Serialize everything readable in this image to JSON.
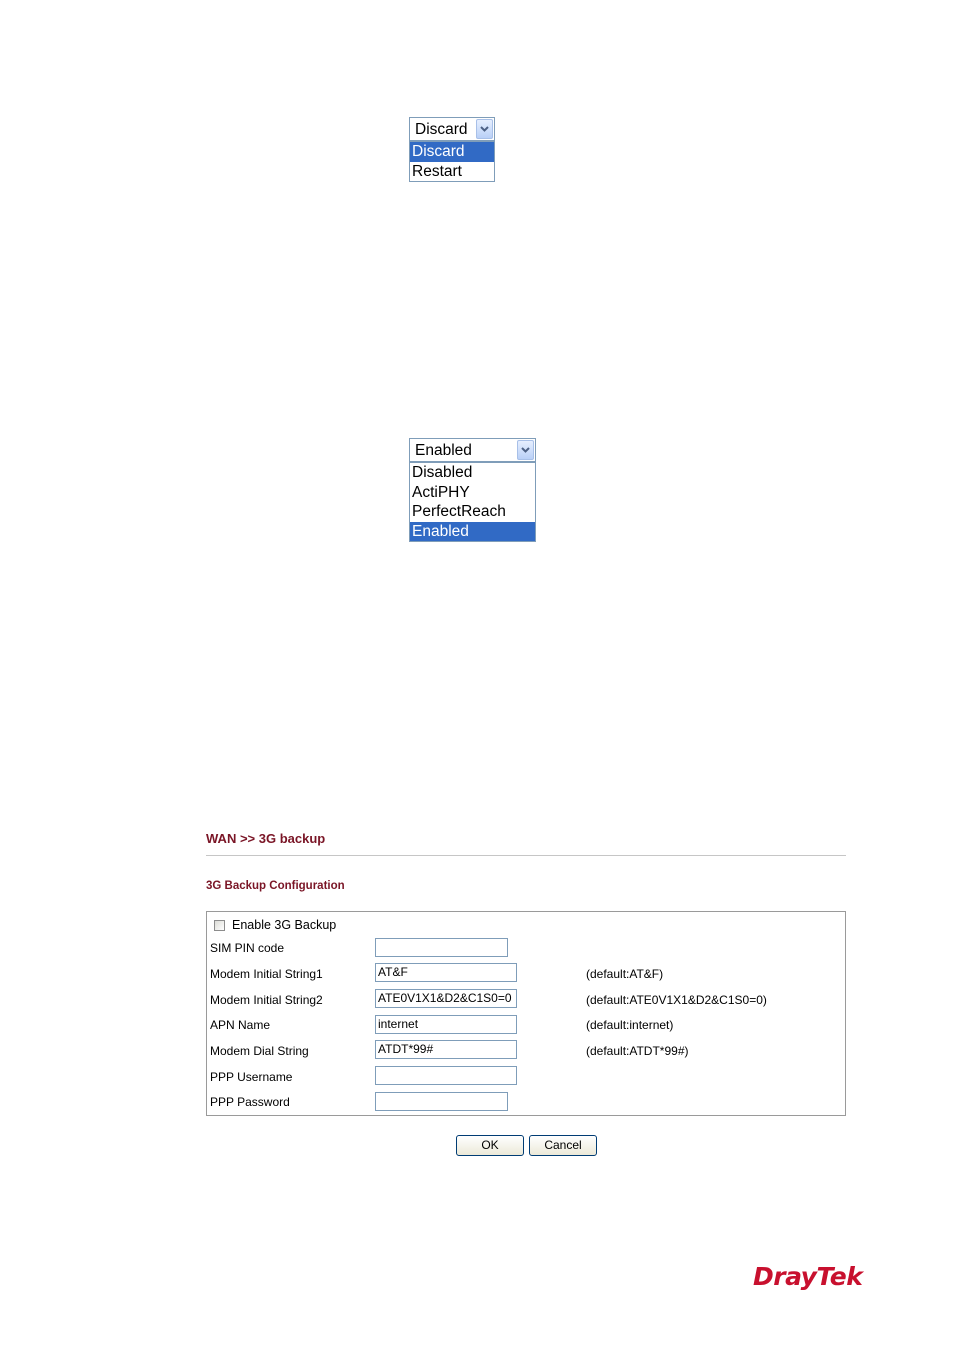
{
  "dropdown_action": {
    "selected": "Discard",
    "options": [
      "Discard",
      "Restart"
    ],
    "highlighted_index": 0
  },
  "dropdown_phy": {
    "selected": "Enabled",
    "options": [
      "Disabled",
      "ActiPHY",
      "PerfectReach",
      "Enabled"
    ],
    "highlighted_index": 3
  },
  "panel": {
    "breadcrumb": "WAN >> 3G backup",
    "section_title": "3G Backup Configuration",
    "enable_label": "Enable 3G Backup",
    "enable_checked": false,
    "fields": [
      {
        "label": "SIM PIN code",
        "value": "",
        "hint": ""
      },
      {
        "label": "Modem Initial String1",
        "value": "AT&F",
        "hint": "(default:AT&F)"
      },
      {
        "label": "Modem Initial String2",
        "value": "ATE0V1X1&D2&C1S0=0",
        "hint": "(default:ATE0V1X1&D2&C1S0=0)"
      },
      {
        "label": "APN Name",
        "value": "internet",
        "hint": "(default:internet)"
      },
      {
        "label": "Modem Dial String",
        "value": "ATDT*99#",
        "hint": "(default:ATDT*99#)"
      },
      {
        "label": "PPP Username",
        "value": "",
        "hint": ""
      },
      {
        "label": "PPP Password",
        "value": "",
        "hint": ""
      }
    ],
    "ok_label": "OK",
    "cancel_label": "Cancel"
  },
  "logo": {
    "text": "DrayTek",
    "color": "#c8102e"
  },
  "colors": {
    "accent": "#7a1526",
    "selection": "#316ac5",
    "border": "#7f9db9"
  }
}
